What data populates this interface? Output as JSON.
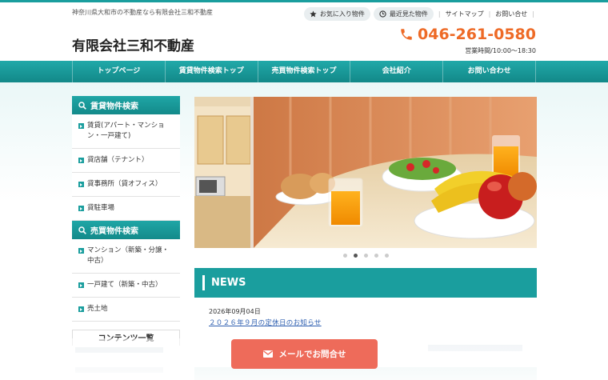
{
  "header": {
    "tagline": "神奈川県大和市の不動産なら有限会社三和不動産",
    "site_name": "有限会社三和不動産",
    "links": {
      "favorites": "お気に入り物件",
      "recently_viewed": "最近見た物件",
      "sitemap": "サイトマップ",
      "contact": "お問い合せ"
    },
    "phone": "046-261-0580",
    "hours": "営業時間/10:00～18:30"
  },
  "nav": [
    "トップページ",
    "賃貸物件検索トップ",
    "売買物件検索トップ",
    "会社紹介",
    "お問い合わせ"
  ],
  "sidebar": {
    "rent_heading": "賃貸物件検索",
    "rent_items": [
      "賃貸(アパート・マンション・一戸建て)",
      "貸店舗（テナント）",
      "貸事務所（貸オフィス）",
      "貸駐車場"
    ],
    "sale_heading": "売買物件検索",
    "sale_items": [
      "マンション（新築・分譲・中古）",
      "一戸建て（新築・中古）",
      "売土地"
    ],
    "contents_heading": "コンテンツ一覧"
  },
  "slider": {
    "dots": 5,
    "active_index": 1
  },
  "news": {
    "heading": "NEWS",
    "items": [
      {
        "date": "2026年09月04日",
        "title": "２０２６年９月の定休日のお知らせ"
      }
    ]
  },
  "cta": {
    "mail_label": "メールでお問合せ"
  },
  "colors": {
    "accent": "#1a9e9e",
    "phone": "#ee6a26",
    "cta": "#ee6b5a",
    "link": "#2e5fb0"
  }
}
